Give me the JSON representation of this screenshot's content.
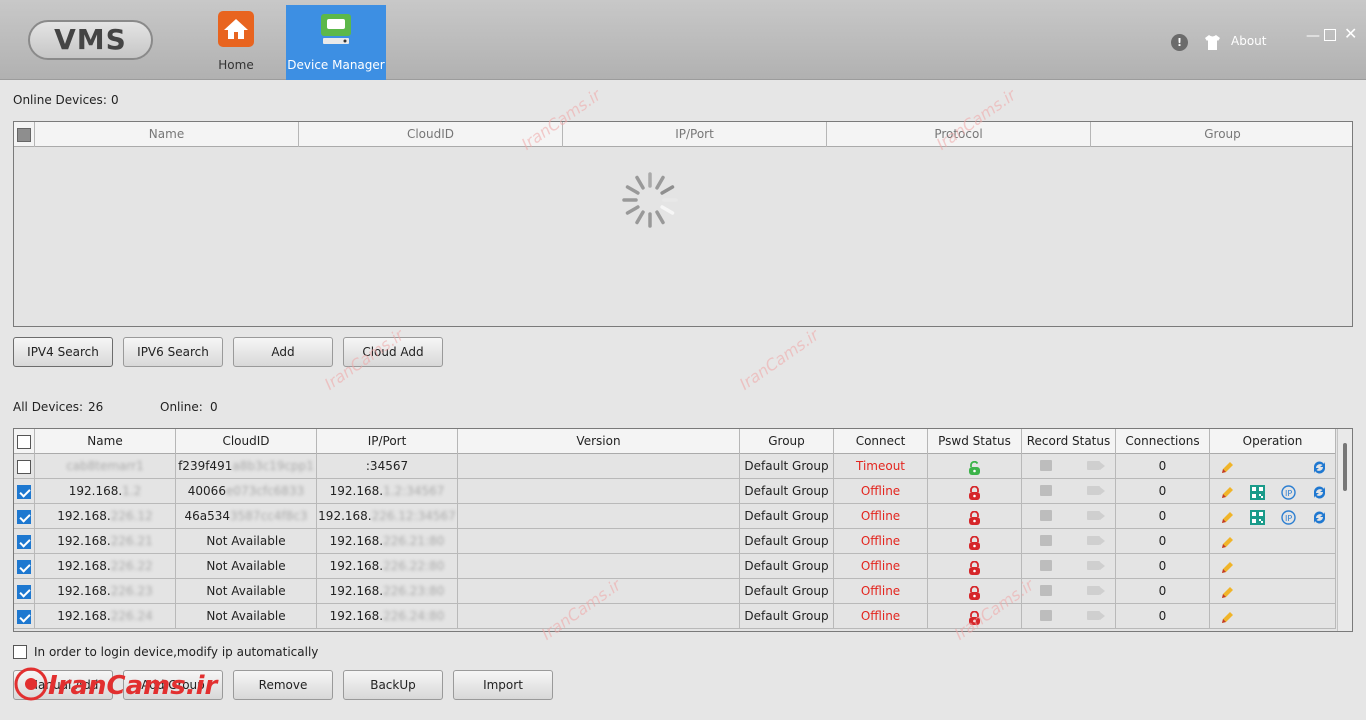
{
  "header": {
    "logo": "VMS",
    "nav": [
      {
        "label": "Home"
      },
      {
        "label": "Device Manager"
      }
    ],
    "about_label": "About",
    "win_min": "—",
    "win_close": "✕"
  },
  "online_section": {
    "label": "Online Devices:",
    "count": "0",
    "columns": [
      "Name",
      "CloudID",
      "IP/Port",
      "Protocol",
      "Group"
    ]
  },
  "search_buttons": [
    "IPV4 Search",
    "IPV6 Search",
    "Add",
    "Cloud Add"
  ],
  "all_section": {
    "all_label": "All Devices:",
    "all_count": "26",
    "online_label": "Online:",
    "online_count": "0",
    "columns": [
      "Name",
      "CloudID",
      "IP/Port",
      "Version",
      "Group",
      "Connect",
      "Pswd Status",
      "Record Status",
      "Connections",
      "Operation"
    ],
    "rows": [
      {
        "checked": false,
        "name": "",
        "name_hidden": "cab8temarr1",
        "cloud": "f239f491",
        "cloud_hidden": "a8b3c19cpp1",
        "ip": ":34567",
        "ip_prefix": "",
        "ip_hidden": "",
        "group": "Default Group",
        "connect": "Timeout",
        "pswd": "unlocked",
        "connections": "0",
        "ops": [
          "edit",
          "refresh"
        ]
      },
      {
        "checked": true,
        "name": "192.168.",
        "name_hidden": "1.2",
        "cloud": "40066",
        "cloud_hidden": "e073cfc6833",
        "ip": "192.168.",
        "ip_prefix": "",
        "ip_hidden": "1.2:34567",
        "group": "Default Group",
        "connect": "Offline",
        "pswd": "locked",
        "connections": "0",
        "ops": [
          "edit",
          "qr",
          "ip",
          "refresh"
        ]
      },
      {
        "checked": true,
        "name": "192.168.",
        "name_hidden": "226.12",
        "cloud": "46a534",
        "cloud_hidden": "3587cc4f8c3",
        "ip": "192.168.",
        "ip_prefix": "",
        "ip_hidden": "226.12:34567",
        "group": "Default Group",
        "connect": "Offline",
        "pswd": "locked",
        "connections": "0",
        "ops": [
          "edit",
          "qr",
          "ip",
          "refresh"
        ]
      },
      {
        "checked": true,
        "name": "192.168.",
        "name_hidden": "226.21",
        "cloud": "Not Available",
        "cloud_hidden": "",
        "ip": "192.168.",
        "ip_prefix": "",
        "ip_hidden": "226.21:80",
        "group": "Default Group",
        "connect": "Offline",
        "pswd": "locked",
        "connections": "0",
        "ops": [
          "edit"
        ]
      },
      {
        "checked": true,
        "name": "192.168.",
        "name_hidden": "226.22",
        "cloud": "Not Available",
        "cloud_hidden": "",
        "ip": "192.168.",
        "ip_prefix": "",
        "ip_hidden": "226.22:80",
        "group": "Default Group",
        "connect": "Offline",
        "pswd": "locked",
        "connections": "0",
        "ops": [
          "edit"
        ]
      },
      {
        "checked": true,
        "name": "192.168.",
        "name_hidden": "226.23",
        "cloud": "Not Available",
        "cloud_hidden": "",
        "ip": "192.168.",
        "ip_prefix": "",
        "ip_hidden": "226.23:80",
        "group": "Default Group",
        "connect": "Offline",
        "pswd": "locked",
        "connections": "0",
        "ops": [
          "edit"
        ]
      },
      {
        "checked": true,
        "name": "192.168.",
        "name_hidden": "226.24",
        "cloud": "Not Available",
        "cloud_hidden": "",
        "ip": "192.168.",
        "ip_prefix": "",
        "ip_hidden": "226.24:80",
        "group": "Default Group",
        "connect": "Offline",
        "pswd": "locked",
        "connections": "0",
        "ops": [
          "edit"
        ]
      }
    ]
  },
  "auto_ip_label": "In order to login device,modify ip automatically",
  "bottom_buttons": [
    "Manual Add",
    "Add Group",
    "Remove",
    "BackUp",
    "Import"
  ],
  "watermark": "IranCams.ir",
  "colors": {
    "accent": "#3d8fe3",
    "offline": "#e3261f",
    "home_icon": "#e8641f"
  }
}
